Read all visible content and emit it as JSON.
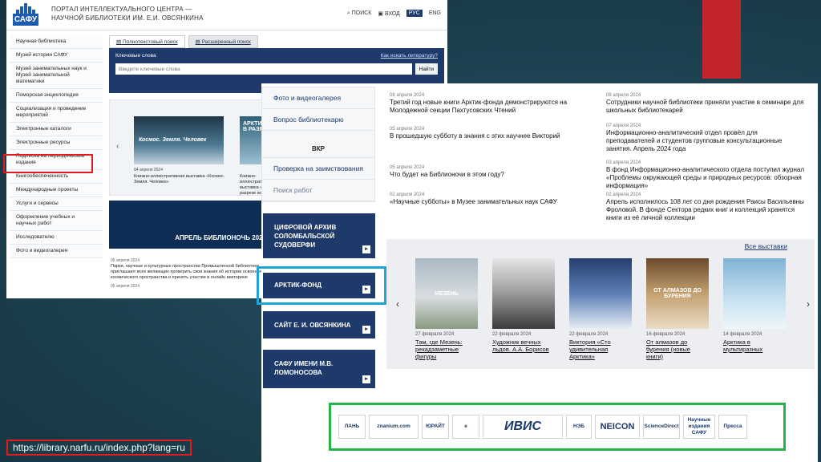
{
  "slide": {
    "url_label": "https://library.narfu.ru/index.php?lang=ru"
  },
  "shot1": {
    "logo_word": "САФУ",
    "portal_title": "ПОРТАЛ ИНТЕЛЛЕКТУАЛЬНОГО ЦЕНТРА — НАУЧНОЙ БИБЛИОТЕКИ ИМ. Е.И. ОВСЯНКИНА",
    "header": {
      "search": "ПОИСК",
      "login": "ВХОД",
      "lang_ru": "РУС",
      "lang_en": "ENG"
    },
    "sidebar": [
      "Научная библиотека",
      "Музей истории САФУ",
      "Музей занимательных наук и Музей занимательной математики",
      "Поморская энциклопедия",
      "Социализация и проведение мероприятий",
      "Электронные каталоги",
      "Электронные ресурсы",
      "Подписка на периодические издания",
      "Книгообеспеченность",
      "Международные проекты",
      "Услуги и сервисы",
      "Оформление учебных и научных работ",
      "Исследователю",
      "Фото и видеогалерея"
    ],
    "tabs": [
      "Полнотекстовый поиск",
      "Расширенный поиск"
    ],
    "search": {
      "label": "Ключевые слова",
      "how_link": "Как искать литературу?",
      "placeholder": "Введите ключевые слова",
      "button": "Найти"
    },
    "banner": {
      "img1_text": "Космос. Земля. Человек",
      "img2_text": "АРКТИКА В РАЗРЕ...",
      "date1": "04 апреля 2024",
      "caption1": "Книжно-иллюстративная выставка «Космос. Земля. Человек»",
      "caption2": "Книжно-иллюстративная выставка «Арктика в разрезе аспектов»"
    },
    "banner2_text": "АПРЕЛЬ БИБЛИОНОЧЬ 2024",
    "news": {
      "date": "05 апреля 2024",
      "text": "Парки, научные и культурные пространства Промышленной библиотеки приглашают всех желающих проверить свои знания об истории освоения космического пространства и принять участие в онлайн викторине",
      "date2": "05 апреля 2024"
    }
  },
  "shot2": {
    "menu": [
      "Фото и видеогалерея",
      "Вопрос библиотекарю",
      "ВКР",
      "Проверка на заимствования",
      "Поиск работ"
    ],
    "buttons": [
      "ЦИФРОВОЙ АРХИВ СОЛОМБАЛЬСКОЙ СУДОВЕРФИ",
      "АРКТИК-ФОНД",
      "САЙТ Е. И. ОВСЯНКИНА",
      "САФУ ИМЕНИ М.В. ЛОМОНОСОВА"
    ],
    "news_left": [
      {
        "date": "08 апреля 2024",
        "title": "Третий год новые книги Арктик-фонда демонстрируются на Молодежной секции Пахтусовских Чтений"
      },
      {
        "date": "05 апреля 2024",
        "title": "В прошедшую субботу в знания с этих научнее Викторий"
      },
      {
        "date": "05 апреля 2024",
        "title": "Что будет на Библионочи в этом году?"
      },
      {
        "date": "02 апреля 2024",
        "title": "«Научные субботы» в Музее занимательных наук САФУ"
      }
    ],
    "news_right": [
      {
        "date": "08 апреля 2024",
        "title": "Сотрудники научной библиотеки приняли участие в семинаре для школьных библиотекарей"
      },
      {
        "date": "07 апреля 2024",
        "title": "Информационно-аналитический отдел провёл для преподавателей и студентов групповые консультационные занятия. Апрель 2024 года"
      },
      {
        "date": "03 апреля 2024",
        "title": "В фонд Информационно-аналитического отдела поступил журнал «Проблемы окружающей среды и природных ресурсов: обзорная информация»"
      },
      {
        "date": "02 апреля 2024",
        "title": "Апрель исполнилось 108 лет со дня рождения Раисы Васильевны Фроловой. В фонде Сектора редких книг и коллекций хранятся книги из её личной коллекции"
      }
    ],
    "gallery": {
      "all_link": "Все выставки",
      "cards": [
        {
          "date": "27 февраля 2024",
          "title": "Там, где Мезень: рекадзаметные фигуры",
          "img_text": "МЕЗЕНЬ"
        },
        {
          "date": "22 февраля 2024",
          "title": "Художник вечных льдов. А.А. Борисов",
          "img_text": ""
        },
        {
          "date": "22 февраля 2024",
          "title": "Виктория «Сто удивительная Арктика»",
          "img_text": ""
        },
        {
          "date": "16 февраля 2024",
          "title": "От алмазов до бурения (новые книги)",
          "img_text": "ОТ АЛМАЗОВ ДО БУРЕНИЯ"
        },
        {
          "date": "14 февраля 2024",
          "title": "Арктика в мультиразных",
          "img_text": ""
        }
      ]
    },
    "partners": [
      "ЛАНЬ",
      "znanium.com",
      "ЮРАЙТ",
      "e",
      "ИВИС",
      "НЭБ",
      "NEICON",
      "ScienceDirect",
      "Научные издания САФУ",
      "Пресса"
    ]
  },
  "colors": {
    "navy": "#1d3a6b",
    "highlight_red": "#e01c1c",
    "highlight_blue": "#1fa3d9",
    "highlight_green": "#29b34a",
    "deco_red": "#c3262a"
  }
}
